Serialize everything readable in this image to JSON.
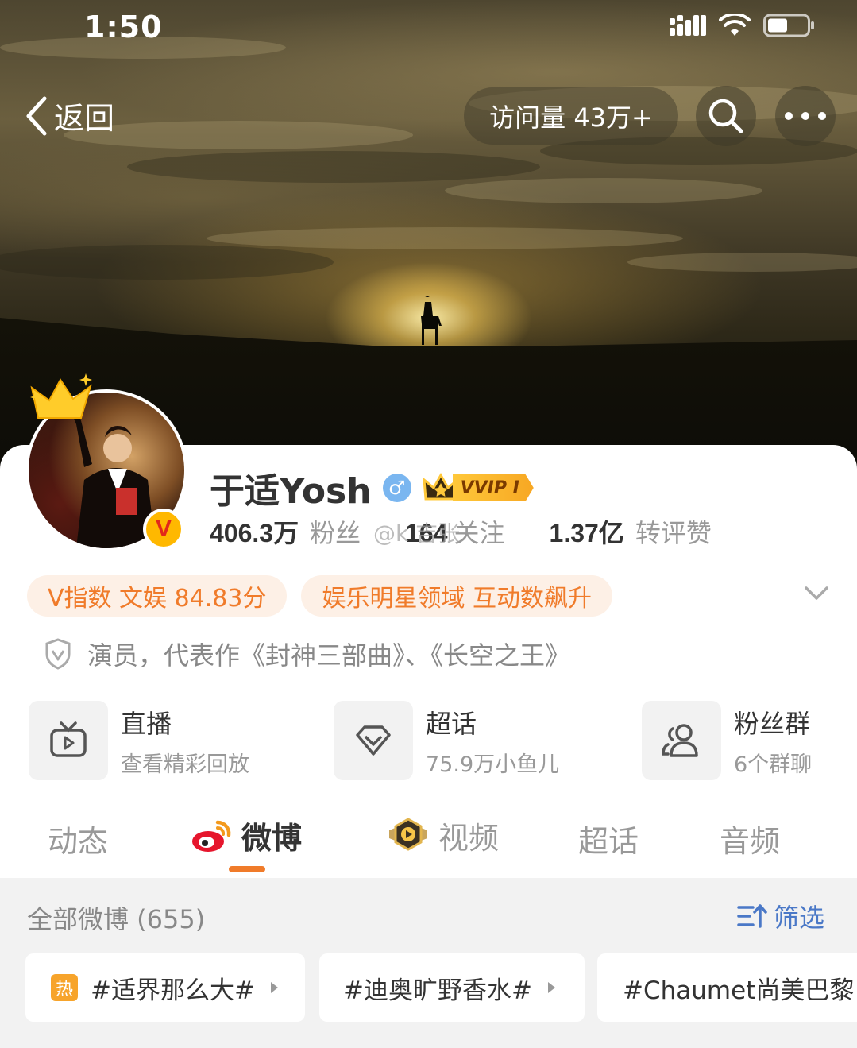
{
  "status_bar": {
    "time": "1:50"
  },
  "nav": {
    "back_label": "返回",
    "visits": "访问量 43万+"
  },
  "profile": {
    "name": "于适Yosh",
    "vip_badge": "VVIP I",
    "followers_count": "406.3万",
    "followers_label": "粉丝",
    "following_count": "164",
    "following_label": "关注",
    "interactions_count": "1.37亿",
    "interactions_label": "转评赞",
    "watermark": "@k 吉张"
  },
  "chips": [
    "V指数 文娱 84.83分",
    "娱乐明星领域 互动数飙升"
  ],
  "bio": "演员，代表作《封神三部曲》、《长空之王》",
  "shortcuts": [
    {
      "title": "直播",
      "sub": "查看精彩回放",
      "icon": "tv-icon"
    },
    {
      "title": "超话",
      "sub": "75.9万小鱼儿",
      "icon": "diamond-icon"
    },
    {
      "title": "粉丝群",
      "sub": "6个群聊",
      "icon": "group-icon"
    }
  ],
  "tabs": [
    "动态",
    "微博",
    "视频",
    "超话",
    "音频"
  ],
  "active_tab": "微博",
  "feed": {
    "title": "全部微博 (655)",
    "filter_label": "筛选"
  },
  "topics": [
    {
      "label": "#适界那么大#",
      "hot_badge": "热"
    },
    {
      "label": "#迪奥旷野香水#"
    },
    {
      "label": "#Chaumet尚美巴黎"
    }
  ],
  "colors": {
    "accent": "#f07b2a",
    "link": "#4a78c7",
    "vip_gold": "#ffc83a"
  }
}
